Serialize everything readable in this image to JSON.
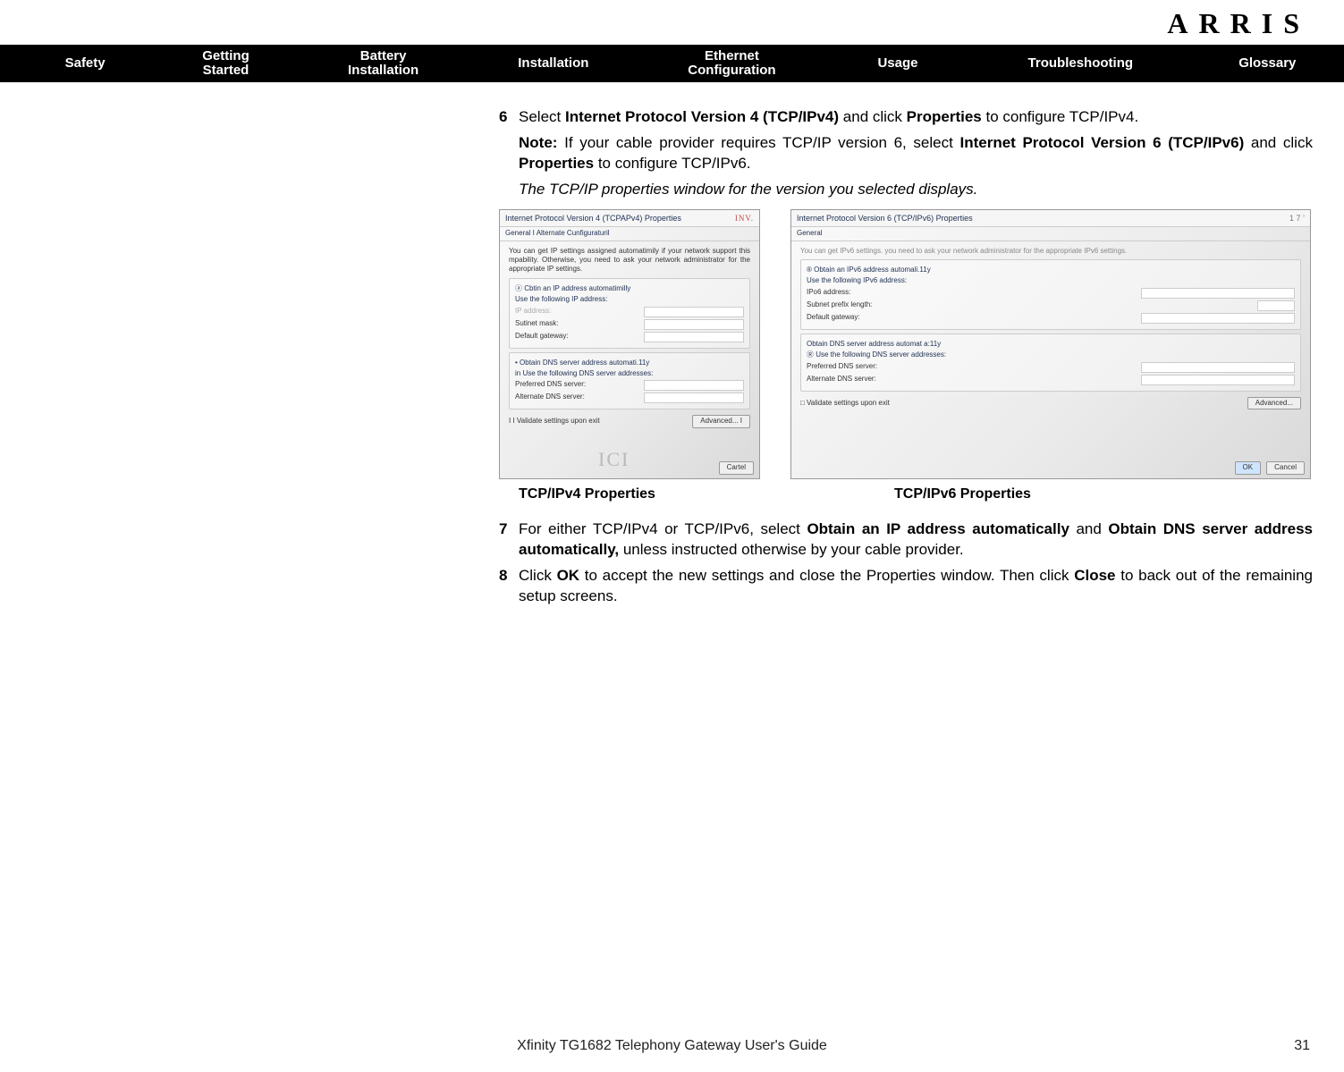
{
  "brand": "ARRIS",
  "nav": {
    "safety": "Safety",
    "getting_started_l1": "Getting",
    "getting_started_l2": "Started",
    "battery_l1": "Battery",
    "battery_l2": "Installation",
    "installation": "Installation",
    "ethernet_l1": "Ethernet",
    "ethernet_l2": "Configuration",
    "usage": "Usage",
    "troubleshooting": "Troubleshooting",
    "glossary": "Glossary"
  },
  "step6_num": "6",
  "step6_pre": " Select ",
  "step6_b1": "Internet Protocol Version 4 (TCP/IPv4)",
  "step6_mid": " and click ",
  "step6_b2": "Properties",
  "step6_post": " to configure TCP/IPv4.",
  "note_label": "Note:",
  "note_text_a": " If your cable provider requires TCP/IP version 6, select ",
  "note_b1": "Internet Pro­tocol Version 6 (TCP/IPv6)",
  "note_text_b": " and click ",
  "note_b2": "Properties",
  "note_text_c": " to configure TCP/IPv6.",
  "italic_line": "The TCP/IP properties window for the version you selected displays.",
  "dlg4": {
    "title": "Internet Protocol Version 4 (TCPAPv4) Properties",
    "badge": "INV.",
    "tab": "General I Alternate Cunfiguraturil",
    "desc": "You can get IP settings assigned automatimily if your network support this mpability. Otherwise, you need to ask your network administrator for the appropriate IP settings.",
    "r1a": "ⓐ Cbtin an IP address automatimilly",
    "r1b": "Use the following IP address:",
    "f1": "IP address:",
    "f2": "Sutinet mask:",
    "f3": "Default gateway:",
    "r2a": "• Obtain DNS server address automati.11y",
    "r2b": "in Use the following DNS server addresses:",
    "f4": "Preferred DNS server:",
    "f5": "Alternate DNS server:",
    "chk": "I I Validate settings upon exit",
    "adv": "Advanced... I",
    "ok": "Cartel",
    "wm": "ICI"
  },
  "dlg6": {
    "title": "Internet Protocol Version 6 (TCP/IPv6) Properties",
    "badge": "1 7 ’",
    "tab": "General",
    "desc": "You can get IPv6 settings. you need to ask your network administrator for the appropriate IPv6 settings.",
    "r1a": "® Obtain an IPv6 address automali.11y",
    "r1b": "Use the following IPv6 address:",
    "f1": "IPo6 address:",
    "f2": "Subnet prefix length:",
    "f3": "Default gateway:",
    "r2a": "Obtain DNS server address automat a:11y",
    "r2b": "Ⓡ Use the following DNS server addresses:",
    "f4": "Preferred DNS server:",
    "f5": "Alternate DNS server:",
    "chk": "□ Validate settings upon exit",
    "adv": "Advanced...",
    "ok": "OK",
    "cancel": "Cancel"
  },
  "caption4": "TCP/IPv4 Properties",
  "caption6": "TCP/IPv6 Properties",
  "step7_num": "7",
  "step7_a": "For either TCP/IPv4 or TCP/IPv6, select ",
  "step7_b1": "Obtain an IP address automati­cally",
  "step7_b": " and ",
  "step7_b2": "Obtain DNS server address automatically,",
  "step7_c": " unless instructed otherwise by your cable provider.",
  "step8_num": "8",
  "step8_a": " Click ",
  "step8_b1": "OK",
  "step8_b": " to accept the new settings and close the Properties window. Then click ",
  "step8_b2": "Close",
  "step8_c": " to back out of the remaining setup screens.",
  "footer_title": "Xfinity TG1682 Telephony Gateway User's Guide",
  "page_number": "31"
}
